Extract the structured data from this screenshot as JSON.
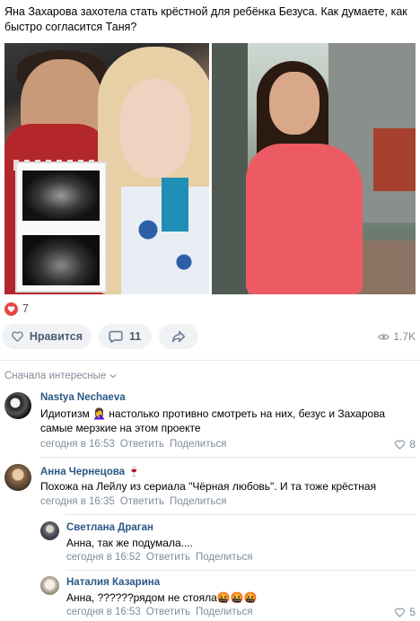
{
  "post": {
    "text": "Яна Захарова захотела стать крёстной для ребёнка Безуса. Как думаете, как быстро согласится Таня?"
  },
  "reactions": {
    "likes_count": "7",
    "like_button_label": "Нравится",
    "comments_count": "11",
    "views": "1.7K"
  },
  "comments_sort": "Сначала интересные",
  "comments": [
    {
      "author": "Nastya Nechaeva",
      "text": "Идиотизм 🤦‍♀️ настолько противно смотреть на них, безус и Захарова самые мерзкие на этом проекте",
      "time": "сегодня в 16:53",
      "reply": "Ответить",
      "share": "Поделиться",
      "likes": "8"
    },
    {
      "author": "Анна Чернецова 🍷",
      "text": "Похожа на Лейлу из сериала \"Чёрная любовь\". И та тоже крёстная",
      "time": "сегодня в 16:35",
      "reply": "Ответить",
      "share": "Поделиться",
      "likes": ""
    },
    {
      "author": "Светлана Драган",
      "text": "Анна, так же подумала....",
      "time": "сегодня в 16:52",
      "reply": "Ответить",
      "share": "Поделиться",
      "likes": ""
    },
    {
      "author": "Наталия Казарина",
      "text": "Анна, ??????рядом не стояла🤬🤬🤬",
      "time": "сегодня в 16:53",
      "reply": "Ответить",
      "share": "Поделиться",
      "likes": "5"
    }
  ],
  "colors": {
    "link": "#2a5885",
    "muted": "#818c99",
    "heart": "#e64646",
    "pill_bg": "#f0f2f5"
  }
}
